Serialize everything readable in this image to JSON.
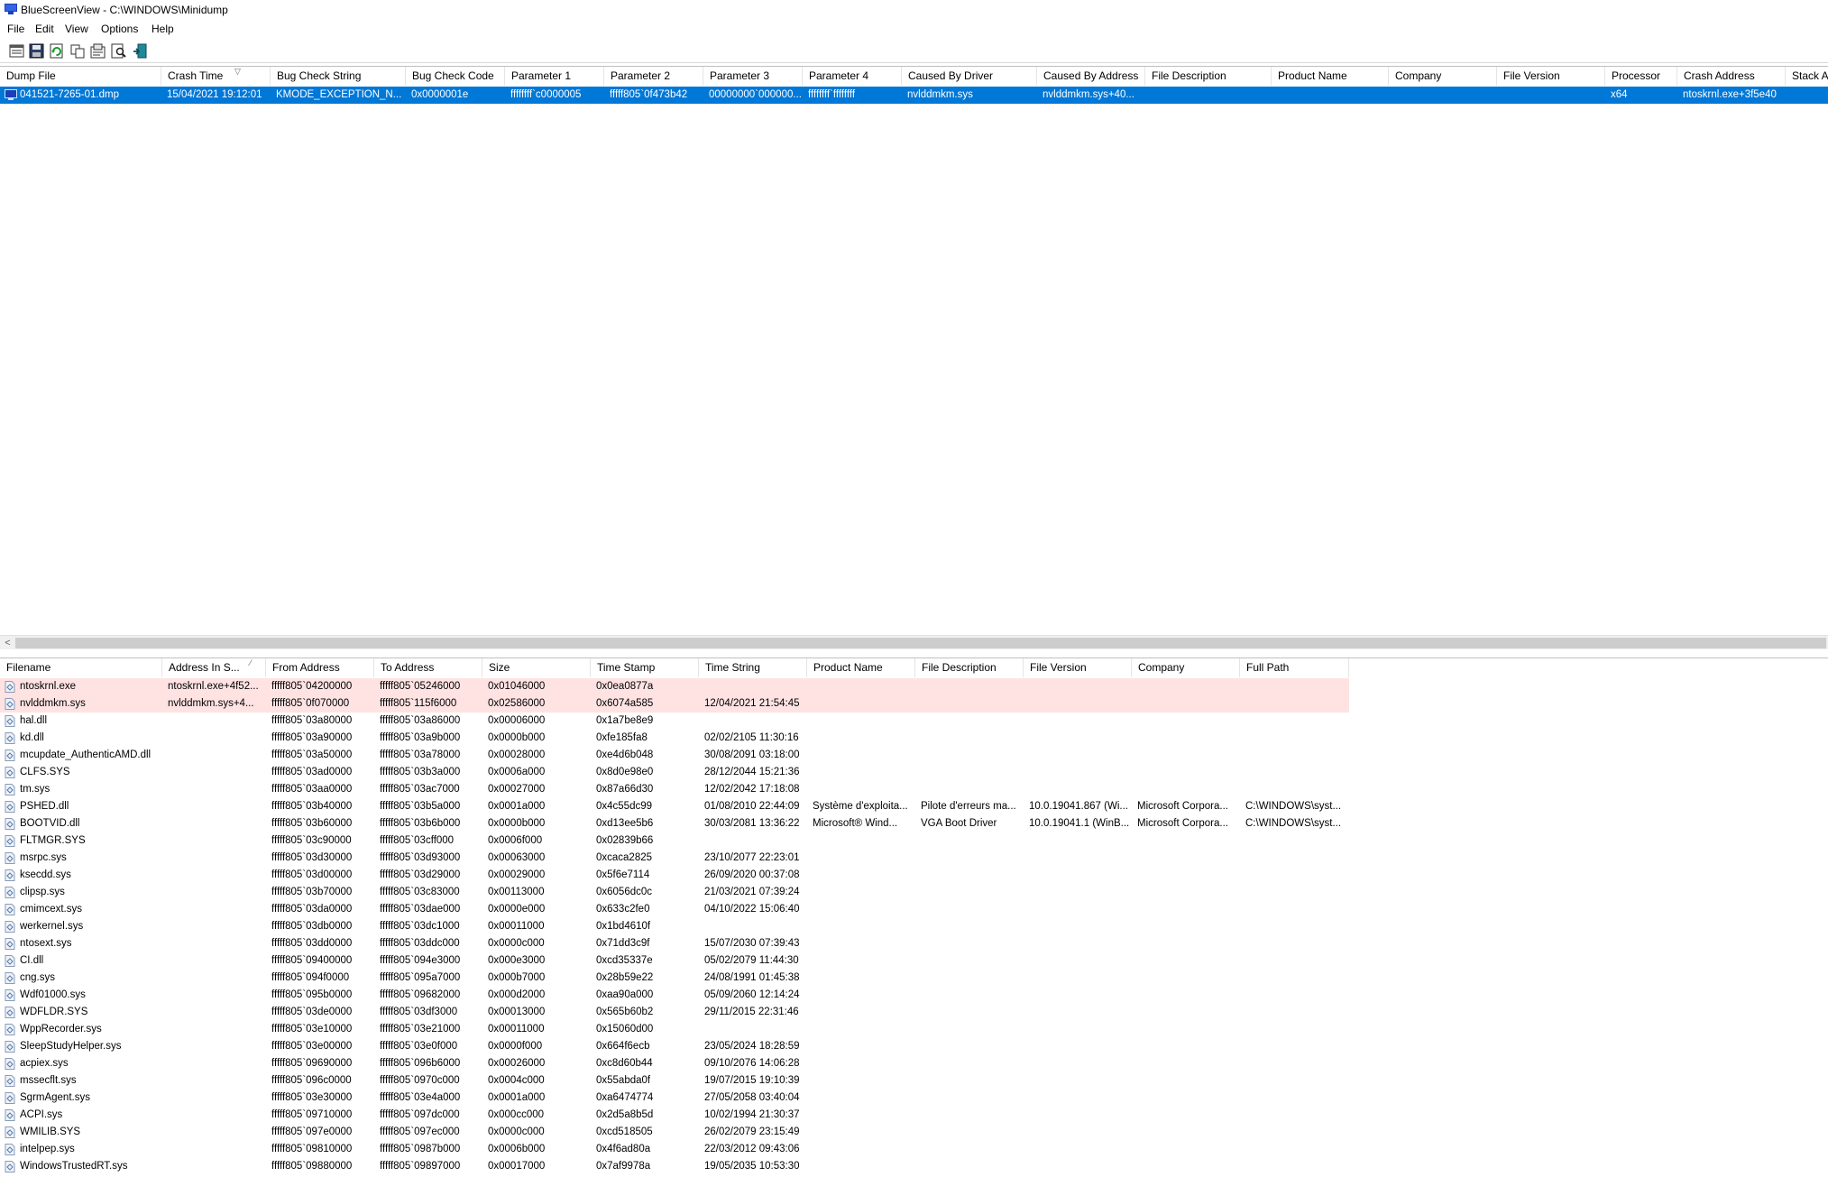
{
  "window": {
    "title": "BlueScreenView  -  C:\\WINDOWS\\Minidump"
  },
  "menu": [
    "File",
    "Edit",
    "View",
    "Options",
    "Help"
  ],
  "toolbar": [
    "properties-icon",
    "save-icon",
    "refresh-icon",
    "copy-icon",
    "html-report-icon",
    "find-icon",
    "exit-icon"
  ],
  "dump_list": {
    "columns": [
      "Dump File",
      "Crash Time",
      "Bug Check String",
      "Bug Check Code",
      "Parameter 1",
      "Parameter 2",
      "Parameter 3",
      "Parameter 4",
      "Caused By Driver",
      "Caused By Address",
      "File Description",
      "Product Name",
      "Company",
      "File Version",
      "Processor",
      "Crash Address",
      "Stack A"
    ],
    "sort_column": 1,
    "rows": [
      [
        "041521-7265-01.dmp",
        "15/04/2021 19:12:01",
        "KMODE_EXCEPTION_N...",
        "0x0000001e",
        "ffffffff`c0000005",
        "fffff805`0f473b42",
        "00000000`000000...",
        "ffffffff`ffffffff",
        "nvlddmkm.sys",
        "nvlddmkm.sys+40...",
        "",
        "",
        "",
        "",
        "x64",
        "ntoskrnl.exe+3f5e40",
        ""
      ]
    ],
    "selected_row": 0
  },
  "scrollbar": {
    "left_arrow": "<"
  },
  "module_list": {
    "columns": [
      "Filename",
      "Address In S...",
      "From Address",
      "To Address",
      "Size",
      "Time Stamp",
      "Time String",
      "Product Name",
      "File Description",
      "File Version",
      "Company",
      "Full Path"
    ],
    "sort_column": 1,
    "highlight_color": "#ffe3e3",
    "rows": [
      [
        "ntoskrnl.exe",
        "ntoskrnl.exe+4f52...",
        "fffff805`04200000",
        "fffff805`05246000",
        "0x01046000",
        "0x0ea0877a",
        "",
        "",
        "",
        "",
        "",
        ""
      ],
      [
        "nvlddmkm.sys",
        "nvlddmkm.sys+4...",
        "fffff805`0f070000",
        "fffff805`115f6000",
        "0x02586000",
        "0x6074a585",
        "12/04/2021 21:54:45",
        "",
        "",
        "",
        "",
        ""
      ],
      [
        "hal.dll",
        "",
        "fffff805`03a80000",
        "fffff805`03a86000",
        "0x00006000",
        "0x1a7be8e9",
        "",
        "",
        "",
        "",
        "",
        ""
      ],
      [
        "kd.dll",
        "",
        "fffff805`03a90000",
        "fffff805`03a9b000",
        "0x0000b000",
        "0xfe185fa8",
        "02/02/2105 11:30:16",
        "",
        "",
        "",
        "",
        ""
      ],
      [
        "mcupdate_AuthenticAMD.dll",
        "",
        "fffff805`03a50000",
        "fffff805`03a78000",
        "0x00028000",
        "0xe4d6b048",
        "30/08/2091 03:18:00",
        "",
        "",
        "",
        "",
        ""
      ],
      [
        "CLFS.SYS",
        "",
        "fffff805`03ad0000",
        "fffff805`03b3a000",
        "0x0006a000",
        "0x8d0e98e0",
        "28/12/2044 15:21:36",
        "",
        "",
        "",
        "",
        ""
      ],
      [
        "tm.sys",
        "",
        "fffff805`03aa0000",
        "fffff805`03ac7000",
        "0x00027000",
        "0x87a66d30",
        "12/02/2042 17:18:08",
        "",
        "",
        "",
        "",
        ""
      ],
      [
        "PSHED.dll",
        "",
        "fffff805`03b40000",
        "fffff805`03b5a000",
        "0x0001a000",
        "0x4c55dc99",
        "01/08/2010 22:44:09",
        "Système d'exploita...",
        "Pilote d'erreurs ma...",
        "10.0.19041.867 (Wi...",
        "Microsoft Corpora...",
        "C:\\WINDOWS\\syst..."
      ],
      [
        "BOOTVID.dll",
        "",
        "fffff805`03b60000",
        "fffff805`03b6b000",
        "0x0000b000",
        "0xd13ee5b6",
        "30/03/2081 13:36:22",
        "Microsoft® Wind...",
        "VGA Boot Driver",
        "10.0.19041.1 (WinB...",
        "Microsoft Corpora...",
        "C:\\WINDOWS\\syst..."
      ],
      [
        "FLTMGR.SYS",
        "",
        "fffff805`03c90000",
        "fffff805`03cff000",
        "0x0006f000",
        "0x02839b66",
        "",
        "",
        "",
        "",
        "",
        ""
      ],
      [
        "msrpc.sys",
        "",
        "fffff805`03d30000",
        "fffff805`03d93000",
        "0x00063000",
        "0xcaca2825",
        "23/10/2077 22:23:01",
        "",
        "",
        "",
        "",
        ""
      ],
      [
        "ksecdd.sys",
        "",
        "fffff805`03d00000",
        "fffff805`03d29000",
        "0x00029000",
        "0x5f6e7114",
        "26/09/2020 00:37:08",
        "",
        "",
        "",
        "",
        ""
      ],
      [
        "clipsp.sys",
        "",
        "fffff805`03b70000",
        "fffff805`03c83000",
        "0x00113000",
        "0x6056dc0c",
        "21/03/2021 07:39:24",
        "",
        "",
        "",
        "",
        ""
      ],
      [
        "cmimcext.sys",
        "",
        "fffff805`03da0000",
        "fffff805`03dae000",
        "0x0000e000",
        "0x633c2fe0",
        "04/10/2022 15:06:40",
        "",
        "",
        "",
        "",
        ""
      ],
      [
        "werkernel.sys",
        "",
        "fffff805`03db0000",
        "fffff805`03dc1000",
        "0x00011000",
        "0x1bd4610f",
        "",
        "",
        "",
        "",
        "",
        ""
      ],
      [
        "ntosext.sys",
        "",
        "fffff805`03dd0000",
        "fffff805`03ddc000",
        "0x0000c000",
        "0x71dd3c9f",
        "15/07/2030 07:39:43",
        "",
        "",
        "",
        "",
        ""
      ],
      [
        "CI.dll",
        "",
        "fffff805`09400000",
        "fffff805`094e3000",
        "0x000e3000",
        "0xcd35337e",
        "05/02/2079 11:44:30",
        "",
        "",
        "",
        "",
        ""
      ],
      [
        "cng.sys",
        "",
        "fffff805`094f0000",
        "fffff805`095a7000",
        "0x000b7000",
        "0x28b59e22",
        "24/08/1991 01:45:38",
        "",
        "",
        "",
        "",
        ""
      ],
      [
        "Wdf01000.sys",
        "",
        "fffff805`095b0000",
        "fffff805`09682000",
        "0x000d2000",
        "0xaa90a000",
        "05/09/2060 12:14:24",
        "",
        "",
        "",
        "",
        ""
      ],
      [
        "WDFLDR.SYS",
        "",
        "fffff805`03de0000",
        "fffff805`03df3000",
        "0x00013000",
        "0x565b60b2",
        "29/11/2015 22:31:46",
        "",
        "",
        "",
        "",
        ""
      ],
      [
        "WppRecorder.sys",
        "",
        "fffff805`03e10000",
        "fffff805`03e21000",
        "0x00011000",
        "0x15060d00",
        "",
        "",
        "",
        "",
        "",
        ""
      ],
      [
        "SleepStudyHelper.sys",
        "",
        "fffff805`03e00000",
        "fffff805`03e0f000",
        "0x0000f000",
        "0x664f6ecb",
        "23/05/2024 18:28:59",
        "",
        "",
        "",
        "",
        ""
      ],
      [
        "acpiex.sys",
        "",
        "fffff805`09690000",
        "fffff805`096b6000",
        "0x00026000",
        "0xc8d60b44",
        "09/10/2076 14:06:28",
        "",
        "",
        "",
        "",
        ""
      ],
      [
        "mssecflt.sys",
        "",
        "fffff805`096c0000",
        "fffff805`0970c000",
        "0x0004c000",
        "0x55abda0f",
        "19/07/2015 19:10:39",
        "",
        "",
        "",
        "",
        ""
      ],
      [
        "SgrmAgent.sys",
        "",
        "fffff805`03e30000",
        "fffff805`03e4a000",
        "0x0001a000",
        "0xa6474774",
        "27/05/2058 03:40:04",
        "",
        "",
        "",
        "",
        ""
      ],
      [
        "ACPI.sys",
        "",
        "fffff805`09710000",
        "fffff805`097dc000",
        "0x000cc000",
        "0x2d5a8b5d",
        "10/02/1994 21:30:37",
        "",
        "",
        "",
        "",
        ""
      ],
      [
        "WMILIB.SYS",
        "",
        "fffff805`097e0000",
        "fffff805`097ec000",
        "0x0000c000",
        "0xcd518505",
        "26/02/2079 23:15:49",
        "",
        "",
        "",
        "",
        ""
      ],
      [
        "intelpep.sys",
        "",
        "fffff805`09810000",
        "fffff805`0987b000",
        "0x0006b000",
        "0x4f6ad80a",
        "22/03/2012 09:43:06",
        "",
        "",
        "",
        "",
        ""
      ],
      [
        "WindowsTrustedRT.sys",
        "",
        "fffff805`09880000",
        "fffff805`09897000",
        "0x00017000",
        "0x7af9978a",
        "19/05/2035 10:53:30",
        "",
        "",
        "",
        "",
        ""
      ]
    ],
    "highlighted_rows": [
      0,
      1
    ]
  },
  "colors": {
    "selection": "#0078d7",
    "highlight": "#ffe3e3"
  }
}
